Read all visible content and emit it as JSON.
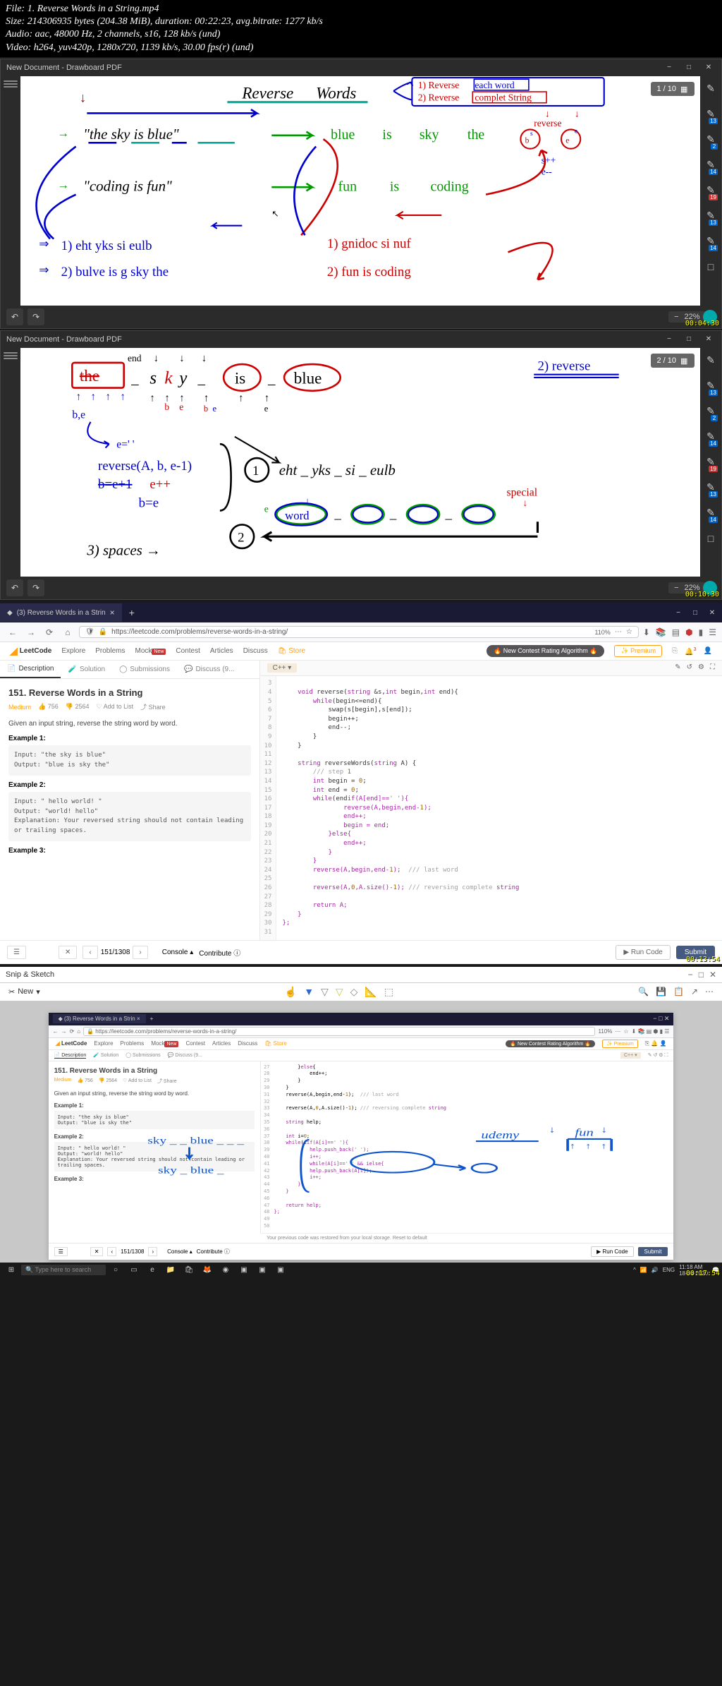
{
  "file_info": {
    "filename": "File: 1. Reverse Words in a String.mp4",
    "size": "Size: 214306935 bytes (204.38 MiB), duration: 00:22:23, avg.bitrate: 1277 kb/s",
    "audio": "Audio: aac, 48000 Hz, 2 channels, s16, 128 kb/s (und)",
    "video": "Video: h264, yuv420p, 1280x720, 1139 kb/s, 30.00 fps(r) (und)"
  },
  "drawboard1": {
    "title": "New Document - Drawboard PDF",
    "page": "1 / 10",
    "zoom": "22%",
    "timestamp": "00:04:30",
    "tool_badge1": "13",
    "tool_badge2": "2",
    "tool_badge3": "14",
    "tool_badge4": "19",
    "tool_badge5": "13",
    "tool_badge6": "14",
    "heading": "Reverse Words",
    "step1": "1) Reverse each word",
    "step2": "2) Reverse complet String",
    "input1": "\"the sky is blue\"",
    "output1_words": "blue is sky the",
    "reverse_label": "reverse",
    "pointer_left": "b,e",
    "pointer_right": "s++ e--",
    "input2": "\"coding is fun\"",
    "output2_words": "fun is coding",
    "result1_1": "1) eht yks si eulb",
    "result1_2": "2) bulve is g sky the",
    "result2_1": "1) gnidoc si nuf",
    "result2_2": "2) fun is coding"
  },
  "drawboard2": {
    "title": "New Document - Drawboard PDF",
    "page": "2 / 10",
    "zoom": "22%",
    "timestamp": "00:10:30",
    "tool_badge1": "13",
    "tool_badge2": "2",
    "tool_badge3": "14",
    "tool_badge4": "19",
    "tool_badge5": "13",
    "tool_badge6": "14",
    "step2_header": "2) reverse",
    "words": "the _ sky _ is _ blue",
    "be_label": "b,e",
    "end_label": "end",
    "reverse_call": "reverse(A, b, e-1)",
    "next1": "e++",
    "next2": "b=e",
    "spaces": "3) spaces →",
    "result1": "1) eht _ yks _ si _ eulb",
    "word_label": "word",
    "special_label": "special"
  },
  "browser1": {
    "tab_title": "(3) Reverse Words in a Strin",
    "url": "https://leetcode.com/problems/reverse-words-in-a-string/",
    "zoom": "110%",
    "timestamp": "00:13:54"
  },
  "leetcode": {
    "logo": "LeetCode",
    "nav": [
      "Explore",
      "Problems",
      "Mock",
      "Contest",
      "Articles",
      "Discuss"
    ],
    "store": "Store",
    "notice": "🔥 New Contest Rating Algorithm 🔥",
    "premium": "✨ Premium",
    "tabs": {
      "description": "Description",
      "solution": "Solution",
      "submissions": "Submissions",
      "discuss": "Discuss (9..."
    },
    "lang": "C++",
    "title": "151. Reverse Words in a String",
    "difficulty": "Medium",
    "likes": "756",
    "dislikes": "2564",
    "addtolist": "Add to List",
    "share": "Share",
    "description": "Given an input string, reverse the string word by word.",
    "ex1_label": "Example 1:",
    "ex1_input": "Input: \"the sky is blue\"",
    "ex1_output": "Output: \"blue is sky the\"",
    "ex2_label": "Example 2:",
    "ex2_input": "Input: \"  hello world!  \"",
    "ex2_output": "Output: \"world! hello\"",
    "ex2_expl": "Explanation: Your reversed string should not contain leading or trailing spaces.",
    "ex3_label": "Example 3:",
    "position": "151/1308",
    "console": "Console",
    "contribute": "Contribute ⓘ",
    "run": "▶ Run Code",
    "submit": "Submit",
    "code_lines": [
      "3",
      "4",
      "5",
      "6",
      "7",
      "8",
      "9",
      "10",
      "11",
      "12",
      "13",
      "14",
      "15",
      "16",
      "17",
      "18",
      "19",
      "20",
      "21",
      "22",
      "23",
      "24",
      "25",
      "26",
      "27",
      "28",
      "29",
      "30",
      "31"
    ],
    "code": "\n    void reverse(string &s,int begin,int end){\n        while(begin<=end){\n            swap(s[begin],s[end]);\n            begin++;\n            end--;\n        }\n    }\n\n    string reverseWords(string A) {\n        /// step 1\n        int begin = 0;\n        int end = 0;\n        while(end<A.size()){\n            if(A[end]==' '){\n                reverse(A,begin,end-1);\n                end++;\n                begin = end;\n            }else{\n                end++;\n            }\n        }\n        reverse(A,begin,end-1);  /// last word\n\n        reverse(A,0,A.size()-1); /// reversing complete string\n\n        return A;\n    }\n};"
  },
  "snip": {
    "title": "Snip & Sketch",
    "new": "New",
    "timestamp": "00:17:54",
    "restore_msg": "Your previous code was restored from your local storage. Reset to default"
  },
  "nested": {
    "tab": "(3) Reverse Words in a Strin",
    "url": "https://leetcode.com/problems/reverse-words-in-a-string/",
    "zoom": "110%",
    "title": "151. Reverse Words in a String",
    "difficulty": "Medium",
    "desc": "Given an input string, reverse the string word by word.",
    "ex1": "Example 1:",
    "ex1_in": "Input: \"the sky is blue\"",
    "ex1_out": "Output: \"blue is sky the\"",
    "ex2": "Example 2:",
    "ex2_in": "Input: \"  hello world!  \"",
    "ex2_out": "Output: \"world! hello\"",
    "ex2_expl": "Explanation: Your reversed string should not contain leading or trailing spaces.",
    "ex3": "Example 3:",
    "position": "151/1308",
    "console": "Console",
    "contribute": "Contribute ⓘ",
    "run": "▶ Run Code",
    "submit": "Submit",
    "annotation1": "sky _ _ blue _ _ _",
    "annotation2": "sky _ blue _",
    "annotation3": "udemy",
    "annotation4": "fun",
    "code_lines": [
      "27",
      "28",
      "29",
      "30",
      "31",
      "32",
      "33",
      "34",
      "35",
      "36",
      "37",
      "38",
      "39",
      "40",
      "41",
      "42",
      "43",
      "44",
      "45",
      "46",
      "47",
      "48",
      "49",
      "50"
    ],
    "code": "        }else{\n            end++;\n        }\n    }\n    reverse(A,begin,end-1);  /// last word\n\n    reverse(A,0,A.size()-1); /// reversing complete string\n\n    string help;\n\n    int i=0;\n    while(i<A.size()){\n        if(A[i]==' '){\n            help.push_back(' ');\n            i++;\n            while(A[i]==' ' && i<A.size())i++;\n        }else{\n            help.push_back(A[i]);\n            i++;\n        }\n    }\n\n    return help;\n};"
  },
  "taskbar": {
    "search": "Type here to search",
    "time": "11:18 AM",
    "date": "18-04-2020"
  }
}
